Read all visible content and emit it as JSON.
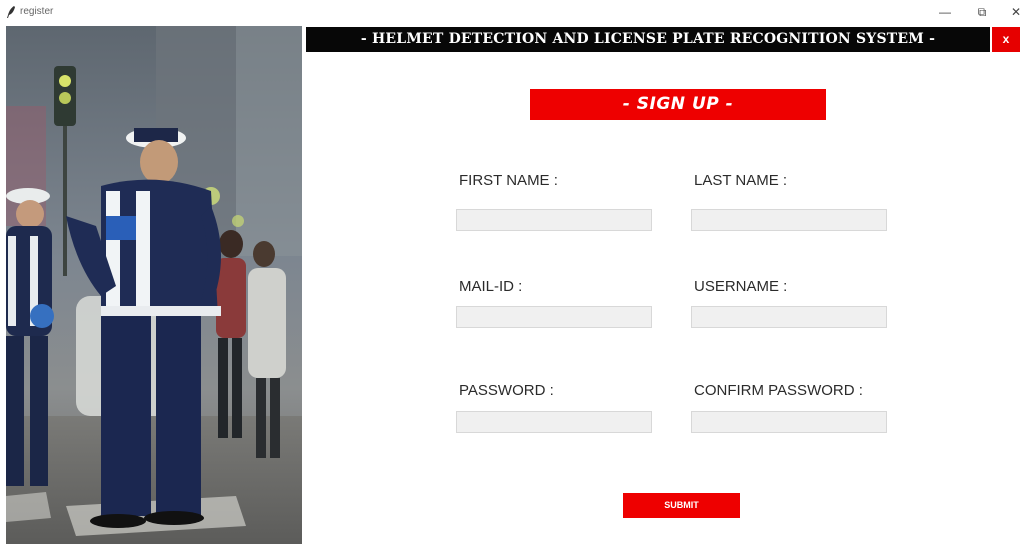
{
  "window": {
    "title": "register",
    "minimize_glyph": "—",
    "maximize_glyph": "⧉",
    "close_glyph": "✕"
  },
  "header": {
    "title": "- HELMET DETECTION AND LICENSE PLATE RECOGNITION SYSTEM -",
    "close_label": "x"
  },
  "form": {
    "heading": "- SIGN UP -",
    "fields": {
      "first_name": {
        "label": "FIRST NAME :",
        "value": ""
      },
      "last_name": {
        "label": "LAST NAME :",
        "value": ""
      },
      "mail_id": {
        "label": "MAIL-ID :",
        "value": ""
      },
      "username": {
        "label": "USERNAME :",
        "value": ""
      },
      "password": {
        "label": "PASSWORD :",
        "value": ""
      },
      "confirm_password": {
        "label": "CONFIRM PASSWORD :",
        "value": ""
      }
    },
    "submit_label": "SUBMIT"
  },
  "colors": {
    "accent_red": "#ee0000",
    "header_black": "#070707",
    "input_bg": "#f0f0f0"
  },
  "icons": {
    "app_icon": "feather-icon",
    "photo": "traffic-police-photo"
  }
}
